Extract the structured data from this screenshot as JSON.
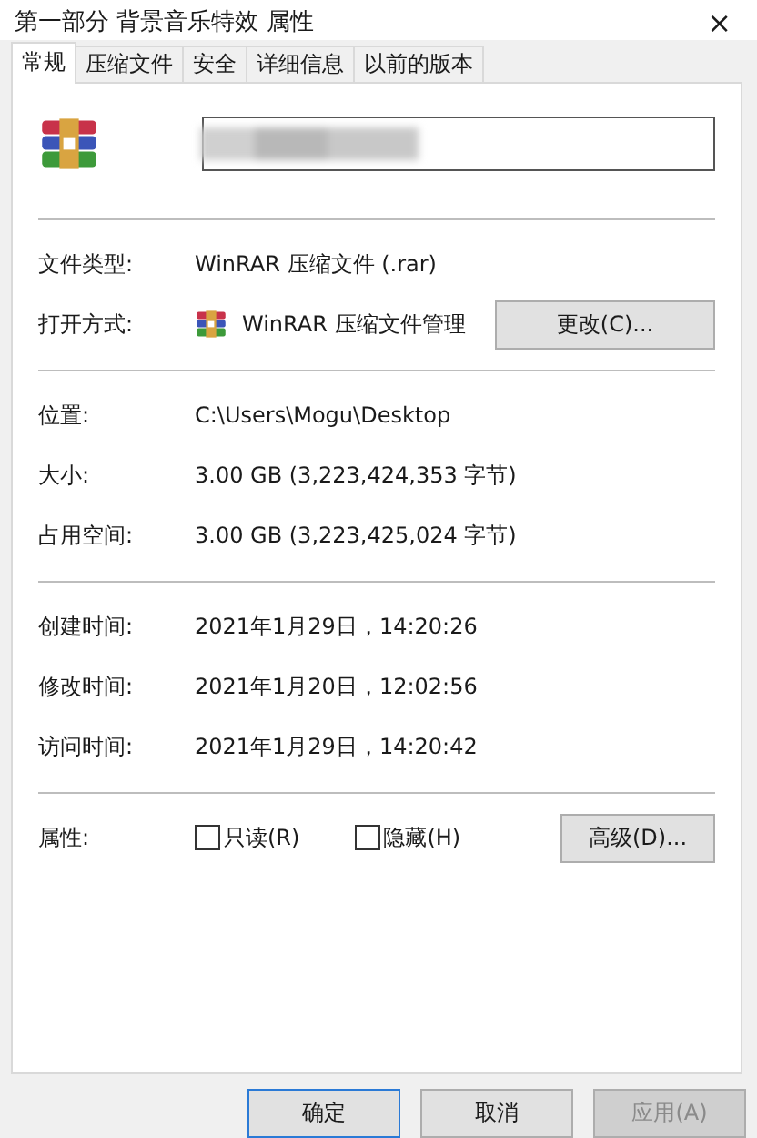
{
  "window": {
    "title": "第一部分 背景音乐特效 属性",
    "close": "×"
  },
  "tabs": [
    {
      "label": "常规",
      "selected": true
    },
    {
      "label": "压缩文件",
      "selected": false
    },
    {
      "label": "安全",
      "selected": false
    },
    {
      "label": "详细信息",
      "selected": false
    },
    {
      "label": "以前的版本",
      "selected": false
    }
  ],
  "type_section": [
    {
      "label": "文件类型:",
      "value": "WinRAR 压缩文件 (.rar)"
    },
    {
      "label": "打开方式:",
      "value": "WinRAR 压缩文件管理",
      "button": "更改(C)..."
    }
  ],
  "location_section": [
    {
      "label": "位置:",
      "value": "C:\\Users\\Mogu\\Desktop"
    },
    {
      "label": "大小:",
      "value": "3.00 GB (3,223,424,353 字节)"
    },
    {
      "label": "占用空间:",
      "value": "3.00 GB (3,223,425,024 字节)"
    }
  ],
  "time_section": [
    {
      "label": "创建时间:",
      "value": "2021年1月29日，14:20:26"
    },
    {
      "label": "修改时间:",
      "value": "2021年1月20日，12:02:56"
    },
    {
      "label": "访问时间:",
      "value": "2021年1月29日，14:20:42"
    }
  ],
  "attributes": {
    "label": "属性:",
    "checkboxes": [
      {
        "label": "只读(R)",
        "checked": false
      },
      {
        "label": "隐藏(H)",
        "checked": false
      }
    ],
    "button": "高级(D)..."
  },
  "buttons": [
    {
      "label": "确定",
      "default": true,
      "disabled": false
    },
    {
      "label": "取消",
      "default": false,
      "disabled": false
    },
    {
      "label": "应用(A)",
      "default": false,
      "disabled": true
    }
  ]
}
